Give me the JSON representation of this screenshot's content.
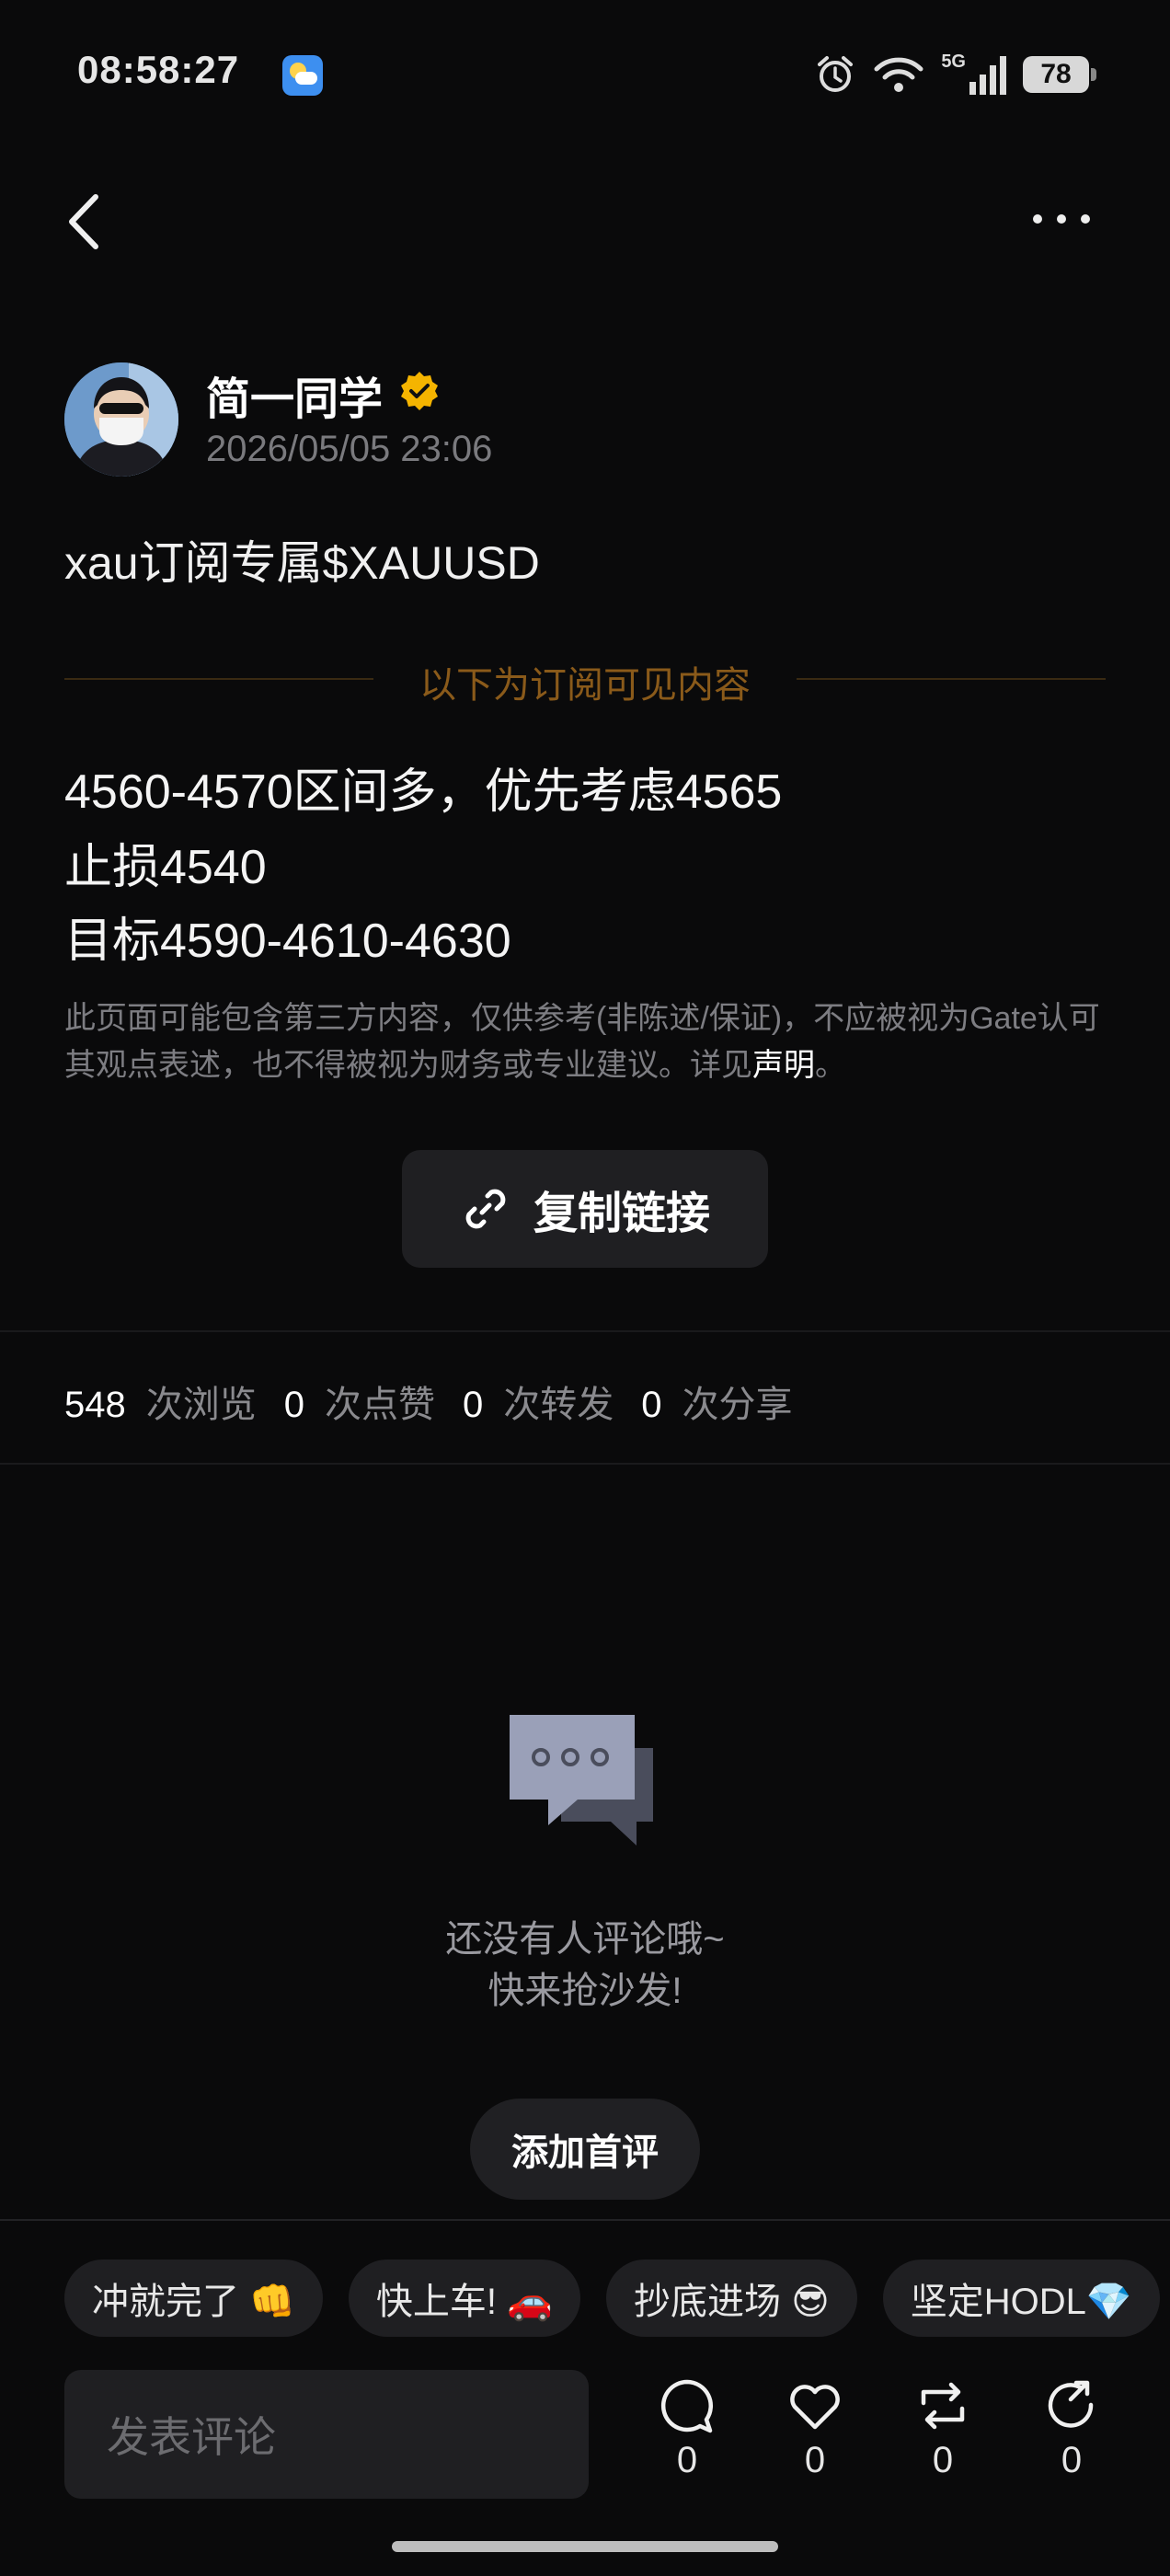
{
  "status_bar": {
    "time": "08:58:27",
    "network": "5G",
    "battery": "78"
  },
  "author": {
    "name": "简一同学",
    "time": "2026/05/05 23:06"
  },
  "post": {
    "title": "xau订阅专属$XAUUSD",
    "divider_label": "以下为订阅可见内容",
    "lines": [
      "4560-4570区间多，优先考虑4565",
      "止损4540",
      "目标4590-4610-4630"
    ],
    "disclaimer": "此页面可能包含第三方内容，仅供参考(非陈述/保证)，不应被视为Gate认可其观点表述，也不得被视为财务或专业建议。详见",
    "disclaimer_link": "声明",
    "disclaimer_end": "。"
  },
  "copy_link_label": "复制链接",
  "stats": [
    {
      "num": "548",
      "label": "次浏览"
    },
    {
      "num": "0",
      "label": "次点赞"
    },
    {
      "num": "0",
      "label": "次转发"
    },
    {
      "num": "0",
      "label": "次分享"
    }
  ],
  "empty": {
    "line1": "还没有人评论哦~",
    "line2": "快来抢沙发!"
  },
  "first_comment_label": "添加首评",
  "chips": [
    "冲就完了 👊",
    "快上车! 🚗",
    "抄底进场 😎",
    "坚定HODL💎"
  ],
  "comment_placeholder": "发表评论",
  "actions": {
    "comment": "0",
    "like": "0",
    "repost": "0",
    "share": "0"
  },
  "colors": {
    "background": "#0a0a0b",
    "divider_text": "#8a5a1a",
    "verified_badge": "#f5b400"
  }
}
